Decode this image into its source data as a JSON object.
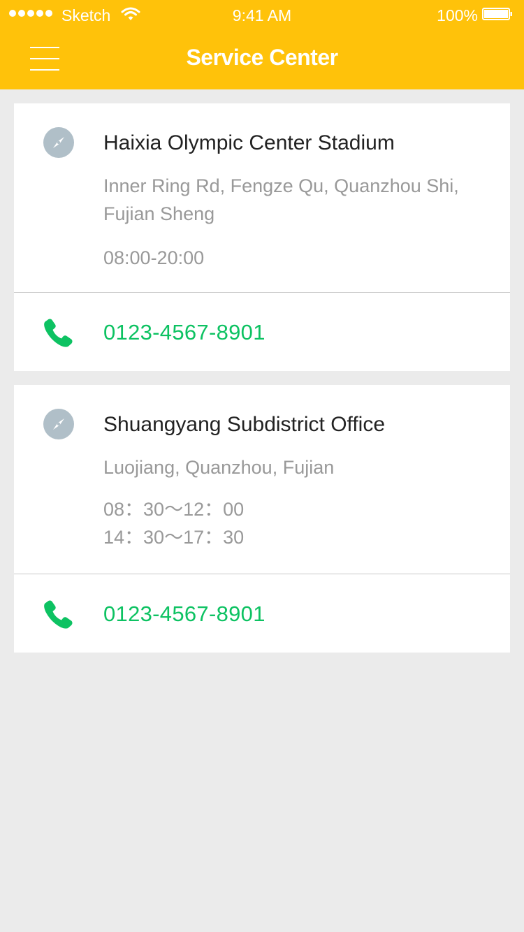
{
  "status_bar": {
    "carrier": "Sketch",
    "time": "9:41 AM",
    "battery": "100%"
  },
  "navbar": {
    "title": "Service Center",
    "menu_icon": "hamburger-menu-icon"
  },
  "colors": {
    "accent": "#ffc20a",
    "phone": "#0dc262",
    "icon_gray": "#b0bfc8"
  },
  "centers": [
    {
      "name": "Haixia Olympic Center Stadium",
      "address": "Inner Ring Rd, Fengze Qu, Quanzhou Shi, Fujian Sheng",
      "hours": [
        "08:00-20:00"
      ],
      "phone": "0123-4567-8901",
      "location_icon": "compass-icon",
      "phone_icon": "phone-icon"
    },
    {
      "name": "Shuangyang Subdistrict Office",
      "address": "Luojiang, Quanzhou, Fujian",
      "hours": [
        "08：30～12：00",
        "14：30～17：30"
      ],
      "phone": "0123-4567-8901",
      "location_icon": "compass-icon",
      "phone_icon": "phone-icon"
    }
  ]
}
